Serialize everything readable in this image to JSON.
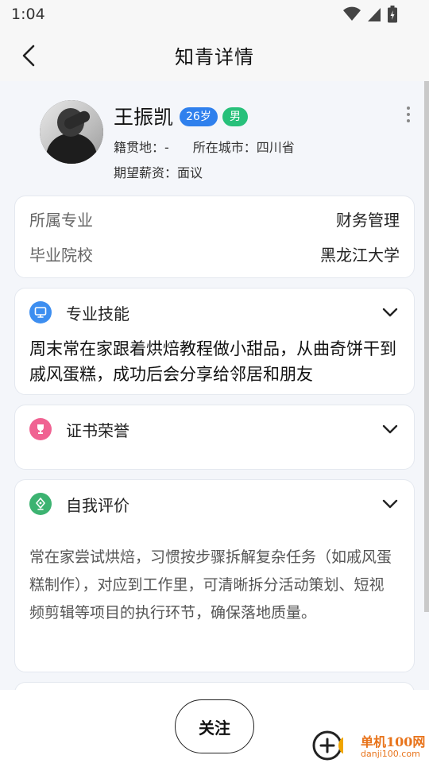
{
  "status_bar": {
    "time": "1:04"
  },
  "nav": {
    "title": "知青详情"
  },
  "profile": {
    "name": "王振凯",
    "age_tag": "26岁",
    "gender_tag": "男",
    "native_place": "籍贯地：-",
    "city": "所在城市：四川省",
    "expected_salary": "期望薪资：面议"
  },
  "education": {
    "major_label": "所属专业",
    "major_value": "财务管理",
    "school_label": "毕业院校",
    "school_value": "黑龙江大学"
  },
  "sections": {
    "skills": {
      "title": "专业技能",
      "icon": "monitor-icon",
      "color": "#3d8ef0",
      "content": "周末常在家跟着烘焙教程做小甜品，从曲奇饼干到戚风蛋糕，成功后会分享给邻居和朋友"
    },
    "certificates": {
      "title": "证书荣誉",
      "icon": "trophy-icon",
      "color": "#f06292"
    },
    "self_evaluation": {
      "title": "自我评价",
      "icon": "pen-nib-icon",
      "color": "#3cb371",
      "content": "常在家尝试烘焙，习惯按步骤拆解复杂任务（如戚风蛋糕制作），对应到工作里，可清晰拆分活动策划、短视频剪辑等项目的执行环节，确保落地质量。"
    }
  },
  "actions": {
    "follow_label": "关注"
  },
  "watermark": {
    "brand": "单机100网",
    "url": "danji100.com"
  }
}
